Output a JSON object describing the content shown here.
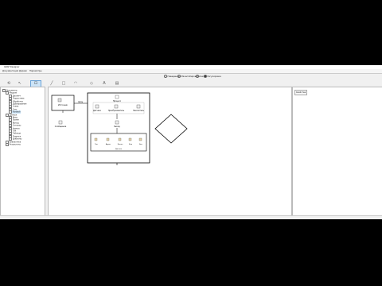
{
  "window": {
    "title": "GRAF Designer"
  },
  "menu": [
    "Документация",
    "Дерево",
    "Параметры"
  ],
  "radios": [
    {
      "label": "Наведение",
      "on": false
    },
    {
      "label": "Масштабировать",
      "on": false
    },
    {
      "label": "Узел",
      "on": false
    },
    {
      "label": "Регулировка",
      "on": true
    }
  ],
  "toolbar": [
    {
      "icon": "refresh-icon",
      "glyph": "⟲",
      "selected": false
    },
    {
      "icon": "pointer-icon",
      "glyph": "↖",
      "selected": false
    },
    {
      "icon": "select-icon",
      "glyph": "⊡",
      "selected": true
    },
    {
      "icon": "line-icon",
      "glyph": "╱",
      "selected": false
    },
    {
      "icon": "rectangle-icon",
      "glyph": "□",
      "selected": false
    },
    {
      "icon": "arc-icon",
      "glyph": "◠",
      "selected": false
    },
    {
      "icon": "diamond-icon",
      "glyph": "◇",
      "selected": false
    },
    {
      "icon": "text-icon",
      "glyph": "A",
      "selected": false
    },
    {
      "icon": "document-icon",
      "glyph": "▤",
      "selected": false
    }
  ],
  "tree": [
    {
      "label": "Документы",
      "indent": 0,
      "selected": false
    },
    {
      "label": "Модули",
      "indent": 1,
      "selected": false
    },
    {
      "label": "Диспетч",
      "indent": 2,
      "selected": false
    },
    {
      "label": "Подсистема",
      "indent": 2,
      "selected": false
    },
    {
      "label": "Обработка",
      "indent": 2,
      "selected": false
    },
    {
      "label": "Дублирование",
      "indent": 2,
      "selected": false
    },
    {
      "label": "Схема",
      "indent": 2,
      "selected": false
    },
    {
      "label": "Сеть",
      "indent": 2,
      "selected": false
    },
    {
      "label": "Узловой",
      "indent": 2,
      "selected": true
    },
    {
      "label": "Данные",
      "indent": 1,
      "selected": false
    },
    {
      "label": "Ввод",
      "indent": 2,
      "selected": false
    },
    {
      "label": "Прием",
      "indent": 2,
      "selected": false
    },
    {
      "label": "Выход",
      "indent": 2,
      "selected": false
    },
    {
      "label": "Сигналы",
      "indent": 2,
      "selected": false
    },
    {
      "label": "Адреса",
      "indent": 2,
      "selected": false
    },
    {
      "label": "Тип",
      "indent": 2,
      "selected": false
    },
    {
      "label": "Таблица",
      "indent": 2,
      "selected": false
    },
    {
      "label": "Подписи",
      "indent": 2,
      "selected": false
    },
    {
      "label": "Шаблоны",
      "indent": 2,
      "selected": false
    },
    {
      "label": "Библиотека",
      "indent": 1,
      "selected": false
    },
    {
      "label": "Результаты",
      "indent": 1,
      "selected": false
    }
  ],
  "diagram": {
    "node_a": "Источник",
    "node_b": "Сообщение",
    "link_label": "связь",
    "group_title": "Процесс",
    "group_items": [
      "Датчики",
      "Преобразователь",
      "Накопитель"
    ],
    "mid_item": "Выход",
    "sub_items": [
      "Тип",
      "Адрес",
      "Канал",
      "Код",
      "Бит"
    ],
    "sub_title": "Данные"
  },
  "right_panel": {
    "button": "Свойства"
  }
}
